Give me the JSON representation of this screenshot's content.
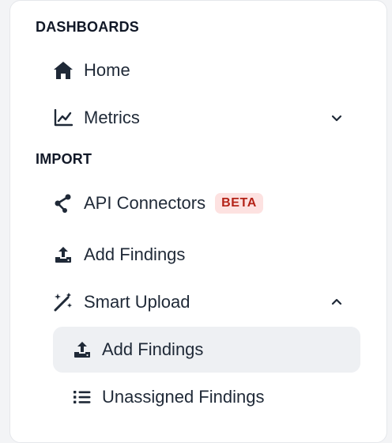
{
  "sections": {
    "dashboards_title": "DASHBOARDS",
    "import_title": "IMPORT"
  },
  "nav": {
    "home": {
      "label": "Home",
      "icon": "home-icon"
    },
    "metrics": {
      "label": "Metrics",
      "icon": "chart-line-icon",
      "expanded": false
    },
    "api_connectors": {
      "label": "API Connectors",
      "icon": "share-nodes-icon",
      "badge": "BETA"
    },
    "add_findings": {
      "label": "Add Findings",
      "icon": "upload-icon"
    },
    "smart_upload": {
      "label": "Smart Upload",
      "icon": "magic-wand-icon",
      "expanded": true
    },
    "smart_upload_children": [
      {
        "label": "Add Findings",
        "icon": "upload-icon",
        "active": true
      },
      {
        "label": "Unassigned Findings",
        "icon": "list-icon",
        "active": false
      }
    ]
  },
  "colors": {
    "text": "#1f2937",
    "heading": "#111827",
    "badge_bg": "#fde2e1",
    "badge_text": "#b42318",
    "active_bg": "#eef0f3"
  }
}
